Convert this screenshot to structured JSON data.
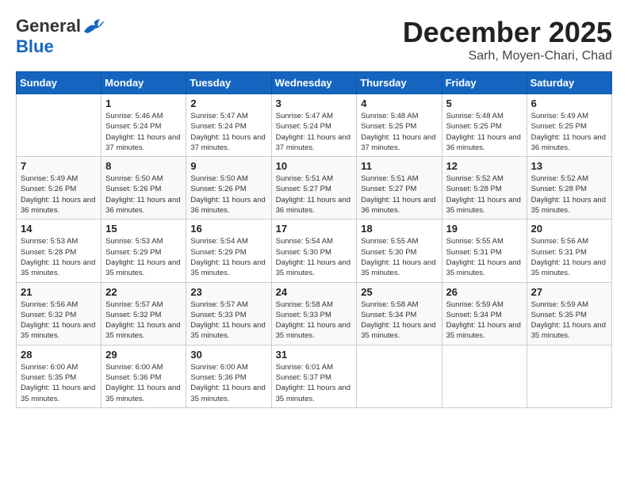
{
  "header": {
    "logo_general": "General",
    "logo_blue": "Blue",
    "month": "December 2025",
    "location": "Sarh, Moyen-Chari, Chad"
  },
  "weekdays": [
    "Sunday",
    "Monday",
    "Tuesday",
    "Wednesday",
    "Thursday",
    "Friday",
    "Saturday"
  ],
  "weeks": [
    [
      {
        "day": "",
        "sunrise": "",
        "sunset": "",
        "daylight": ""
      },
      {
        "day": "1",
        "sunrise": "Sunrise: 5:46 AM",
        "sunset": "Sunset: 5:24 PM",
        "daylight": "Daylight: 11 hours and 37 minutes."
      },
      {
        "day": "2",
        "sunrise": "Sunrise: 5:47 AM",
        "sunset": "Sunset: 5:24 PM",
        "daylight": "Daylight: 11 hours and 37 minutes."
      },
      {
        "day": "3",
        "sunrise": "Sunrise: 5:47 AM",
        "sunset": "Sunset: 5:24 PM",
        "daylight": "Daylight: 11 hours and 37 minutes."
      },
      {
        "day": "4",
        "sunrise": "Sunrise: 5:48 AM",
        "sunset": "Sunset: 5:25 PM",
        "daylight": "Daylight: 11 hours and 37 minutes."
      },
      {
        "day": "5",
        "sunrise": "Sunrise: 5:48 AM",
        "sunset": "Sunset: 5:25 PM",
        "daylight": "Daylight: 11 hours and 36 minutes."
      },
      {
        "day": "6",
        "sunrise": "Sunrise: 5:49 AM",
        "sunset": "Sunset: 5:25 PM",
        "daylight": "Daylight: 11 hours and 36 minutes."
      }
    ],
    [
      {
        "day": "7",
        "sunrise": "Sunrise: 5:49 AM",
        "sunset": "Sunset: 5:26 PM",
        "daylight": "Daylight: 11 hours and 36 minutes."
      },
      {
        "day": "8",
        "sunrise": "Sunrise: 5:50 AM",
        "sunset": "Sunset: 5:26 PM",
        "daylight": "Daylight: 11 hours and 36 minutes."
      },
      {
        "day": "9",
        "sunrise": "Sunrise: 5:50 AM",
        "sunset": "Sunset: 5:26 PM",
        "daylight": "Daylight: 11 hours and 36 minutes."
      },
      {
        "day": "10",
        "sunrise": "Sunrise: 5:51 AM",
        "sunset": "Sunset: 5:27 PM",
        "daylight": "Daylight: 11 hours and 36 minutes."
      },
      {
        "day": "11",
        "sunrise": "Sunrise: 5:51 AM",
        "sunset": "Sunset: 5:27 PM",
        "daylight": "Daylight: 11 hours and 36 minutes."
      },
      {
        "day": "12",
        "sunrise": "Sunrise: 5:52 AM",
        "sunset": "Sunset: 5:28 PM",
        "daylight": "Daylight: 11 hours and 35 minutes."
      },
      {
        "day": "13",
        "sunrise": "Sunrise: 5:52 AM",
        "sunset": "Sunset: 5:28 PM",
        "daylight": "Daylight: 11 hours and 35 minutes."
      }
    ],
    [
      {
        "day": "14",
        "sunrise": "Sunrise: 5:53 AM",
        "sunset": "Sunset: 5:28 PM",
        "daylight": "Daylight: 11 hours and 35 minutes."
      },
      {
        "day": "15",
        "sunrise": "Sunrise: 5:53 AM",
        "sunset": "Sunset: 5:29 PM",
        "daylight": "Daylight: 11 hours and 35 minutes."
      },
      {
        "day": "16",
        "sunrise": "Sunrise: 5:54 AM",
        "sunset": "Sunset: 5:29 PM",
        "daylight": "Daylight: 11 hours and 35 minutes."
      },
      {
        "day": "17",
        "sunrise": "Sunrise: 5:54 AM",
        "sunset": "Sunset: 5:30 PM",
        "daylight": "Daylight: 11 hours and 35 minutes."
      },
      {
        "day": "18",
        "sunrise": "Sunrise: 5:55 AM",
        "sunset": "Sunset: 5:30 PM",
        "daylight": "Daylight: 11 hours and 35 minutes."
      },
      {
        "day": "19",
        "sunrise": "Sunrise: 5:55 AM",
        "sunset": "Sunset: 5:31 PM",
        "daylight": "Daylight: 11 hours and 35 minutes."
      },
      {
        "day": "20",
        "sunrise": "Sunrise: 5:56 AM",
        "sunset": "Sunset: 5:31 PM",
        "daylight": "Daylight: 11 hours and 35 minutes."
      }
    ],
    [
      {
        "day": "21",
        "sunrise": "Sunrise: 5:56 AM",
        "sunset": "Sunset: 5:32 PM",
        "daylight": "Daylight: 11 hours and 35 minutes."
      },
      {
        "day": "22",
        "sunrise": "Sunrise: 5:57 AM",
        "sunset": "Sunset: 5:32 PM",
        "daylight": "Daylight: 11 hours and 35 minutes."
      },
      {
        "day": "23",
        "sunrise": "Sunrise: 5:57 AM",
        "sunset": "Sunset: 5:33 PM",
        "daylight": "Daylight: 11 hours and 35 minutes."
      },
      {
        "day": "24",
        "sunrise": "Sunrise: 5:58 AM",
        "sunset": "Sunset: 5:33 PM",
        "daylight": "Daylight: 11 hours and 35 minutes."
      },
      {
        "day": "25",
        "sunrise": "Sunrise: 5:58 AM",
        "sunset": "Sunset: 5:34 PM",
        "daylight": "Daylight: 11 hours and 35 minutes."
      },
      {
        "day": "26",
        "sunrise": "Sunrise: 5:59 AM",
        "sunset": "Sunset: 5:34 PM",
        "daylight": "Daylight: 11 hours and 35 minutes."
      },
      {
        "day": "27",
        "sunrise": "Sunrise: 5:59 AM",
        "sunset": "Sunset: 5:35 PM",
        "daylight": "Daylight: 11 hours and 35 minutes."
      }
    ],
    [
      {
        "day": "28",
        "sunrise": "Sunrise: 6:00 AM",
        "sunset": "Sunset: 5:35 PM",
        "daylight": "Daylight: 11 hours and 35 minutes."
      },
      {
        "day": "29",
        "sunrise": "Sunrise: 6:00 AM",
        "sunset": "Sunset: 5:36 PM",
        "daylight": "Daylight: 11 hours and 35 minutes."
      },
      {
        "day": "30",
        "sunrise": "Sunrise: 6:00 AM",
        "sunset": "Sunset: 5:36 PM",
        "daylight": "Daylight: 11 hours and 35 minutes."
      },
      {
        "day": "31",
        "sunrise": "Sunrise: 6:01 AM",
        "sunset": "Sunset: 5:37 PM",
        "daylight": "Daylight: 11 hours and 35 minutes."
      },
      {
        "day": "",
        "sunrise": "",
        "sunset": "",
        "daylight": ""
      },
      {
        "day": "",
        "sunrise": "",
        "sunset": "",
        "daylight": ""
      },
      {
        "day": "",
        "sunrise": "",
        "sunset": "",
        "daylight": ""
      }
    ]
  ]
}
